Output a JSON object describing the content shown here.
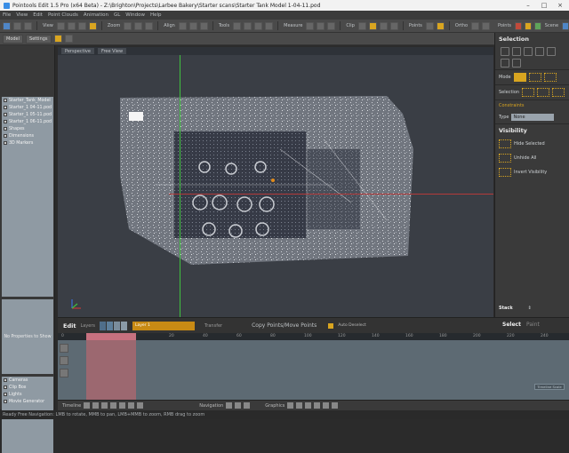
{
  "window": {
    "title": "Pointools Edit 1.5 Pro (x64 Beta) - Z:\\Brighton\\Projects\\Larbee Bakery\\Starter scans\\Starter Tank Model 1-04-11.pod"
  },
  "menu": [
    "File",
    "View",
    "Edit",
    "Point Clouds",
    "Animation",
    "GL",
    "Window",
    "Help"
  ],
  "toolbar": {
    "row1": [
      "View",
      "Zoom",
      "Align",
      "Tools",
      "Measure",
      "Clip",
      "Points",
      "Ortho",
      "Grid",
      "Scene"
    ],
    "row2": [
      "Model",
      "Settings"
    ]
  },
  "tree": {
    "items": [
      "Starter_Tank_Model",
      "Starter_1 04-11.pod",
      "Starter_1 05-11.pod",
      "Starter_1 06-11.pod",
      "Shapes",
      "Dimensions",
      "3D Markers"
    ]
  },
  "properties": {
    "empty_text": "No Properties to Show"
  },
  "layers": {
    "items": [
      "Cameras",
      "Clip Box",
      "Lights",
      "Movie Generator"
    ]
  },
  "viewport": {
    "camera": "Perspective",
    "view": "Free View"
  },
  "right_panel": {
    "selection_title": "Selection",
    "mode_label": "Mode",
    "selection_label": "Selection",
    "constraints_label": "Constraints",
    "type_label": "Type",
    "type_value": "None",
    "visibility_title": "Visibility",
    "hide_selected": "Hide Selected",
    "unhide_all": "Unhide All",
    "invert_visibility": "Invert Visibility",
    "stack_label": "Stack"
  },
  "edit_bar": {
    "title": "Edit",
    "layers_label": "Layers",
    "active_layer": "Layer 1",
    "transfer_label": "Transfer",
    "copy_move": "Copy Points/Move Points",
    "auto_deselect": "Auto Deselect",
    "select_tab": "Select",
    "paint_tab": "Paint"
  },
  "timeline": {
    "start": "0",
    "ruler": [
      "20",
      "40",
      "60",
      "80",
      "100",
      "120",
      "140",
      "160",
      "180",
      "200",
      "220",
      "240",
      "260",
      "280"
    ],
    "tag": "Timeline Scale"
  },
  "nav_bar": {
    "timeline_label": "Timeline",
    "navigation_label": "Navigation",
    "graphics_label": "Graphics"
  },
  "status": "Ready   Free Navigation: LMB to rotate, MMB to pan, LMB+MMB to zoom, RMB drag to zoom"
}
